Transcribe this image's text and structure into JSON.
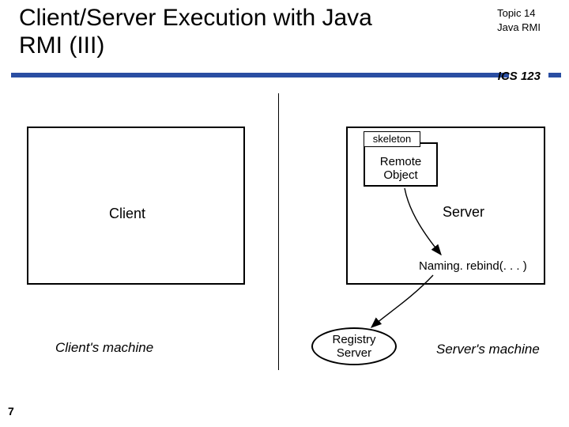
{
  "header": {
    "title": "Client/Server Execution with Java RMI (III)",
    "topic_line1": "Topic 14",
    "topic_line2": "Java RMI",
    "course": "ICS 123"
  },
  "client": {
    "label": "Client",
    "machine": "Client's machine"
  },
  "server": {
    "label": "Server",
    "machine": "Server's machine",
    "remote_object_line1": "Remote",
    "remote_object_line2": "Object",
    "skeleton": "skeleton",
    "naming_call": "Naming. rebind(. . . )"
  },
  "registry": {
    "line1": "Registry",
    "line2": "Server"
  },
  "page": {
    "number": "7"
  }
}
